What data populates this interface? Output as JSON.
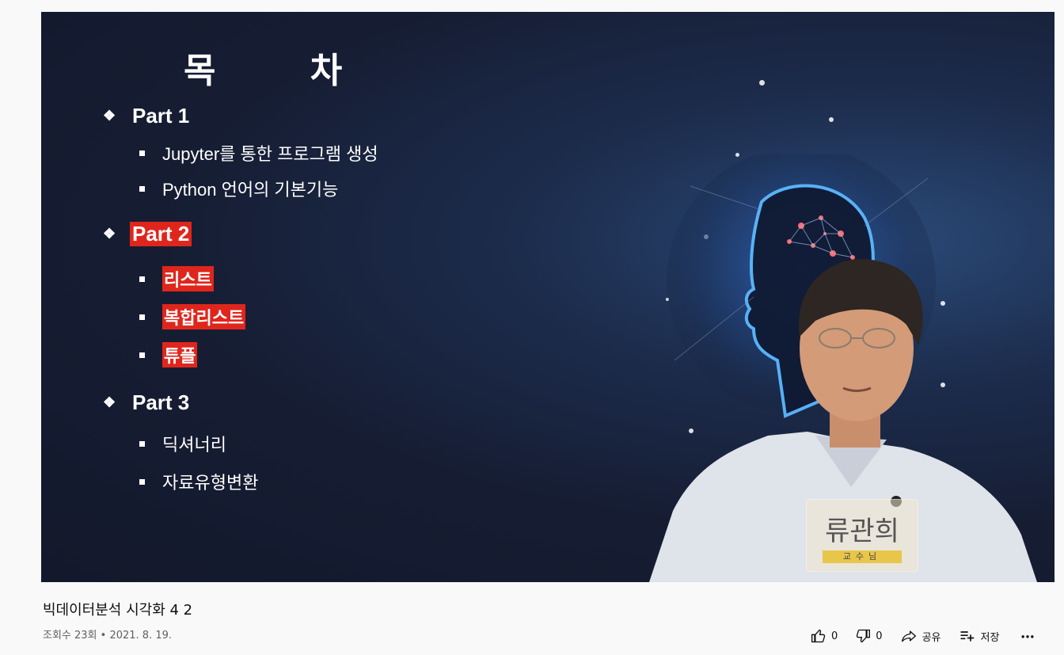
{
  "slide": {
    "title": "목 차",
    "parts": [
      {
        "label": "Part 1",
        "highlight": false,
        "items": [
          {
            "text": "Jupyter를 통한 프로그램 생성",
            "highlight": false
          },
          {
            "text": "Python 언어의 기본기능",
            "highlight": false
          }
        ]
      },
      {
        "label": "Part 2",
        "highlight": true,
        "items": [
          {
            "text": "리스트",
            "highlight": true
          },
          {
            "text": "복합리스트",
            "highlight": true
          },
          {
            "text": "튜플",
            "highlight": true
          }
        ]
      },
      {
        "label": "Part 3",
        "highlight": false,
        "items": [
          {
            "text": "딕셔너리",
            "highlight": false
          },
          {
            "text": "자료유형변환",
            "highlight": false
          }
        ]
      }
    ],
    "highlight_color": "#e0261c",
    "nametag": {
      "name": "류관희",
      "subtitle": "교수님"
    }
  },
  "video": {
    "title": "빅데이터분석 시각화 4 2",
    "meta": "조회수 23회 • 2021. 8. 19."
  },
  "actions": {
    "like_count": "0",
    "dislike_count": "0",
    "share_label": "공유",
    "save_label": "저장",
    "more_icon": "more-horizontal-icon"
  }
}
